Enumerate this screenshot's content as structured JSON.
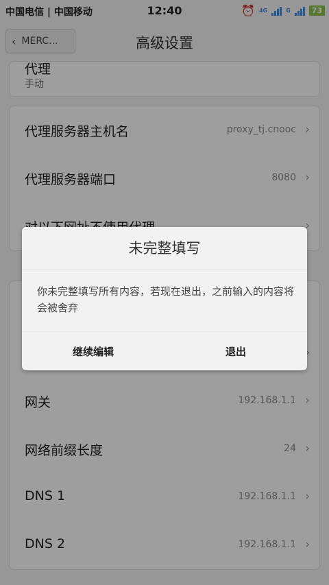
{
  "status_bar": {
    "carriers": "中国电信 | 中国移动",
    "time": "12:40",
    "network_labels": [
      "4G",
      "G"
    ],
    "battery": "73"
  },
  "header": {
    "back_label": "MERC...",
    "title": "高级设置"
  },
  "proxy": {
    "label": "代理",
    "value": "手动"
  },
  "proxy_settings": [
    {
      "label": "代理服务器主机名",
      "value": "proxy_tj.cnooc"
    },
    {
      "label": "代理服务器端口",
      "value": "8080"
    },
    {
      "label": "对以下网址不使用代理",
      "value": ""
    }
  ],
  "ip_settings": [
    {
      "label": "网关",
      "value": "192.168.1.1"
    },
    {
      "label": "网络前缀长度",
      "value": "24"
    },
    {
      "label": "DNS 1",
      "value": "192.168.1.1"
    },
    {
      "label": "DNS 2",
      "value": "192.168.1.1"
    }
  ],
  "dialog": {
    "title": "未完整填写",
    "message": "你未完整填写所有内容，若现在退出，之前输入的内容将会被舍弃",
    "continue_label": "继续编辑",
    "exit_label": "退出"
  },
  "colors": {
    "accent": "#3a8ee6",
    "battery": "#8bc34a",
    "overlay": "rgba(0,0,0,0.38)"
  }
}
